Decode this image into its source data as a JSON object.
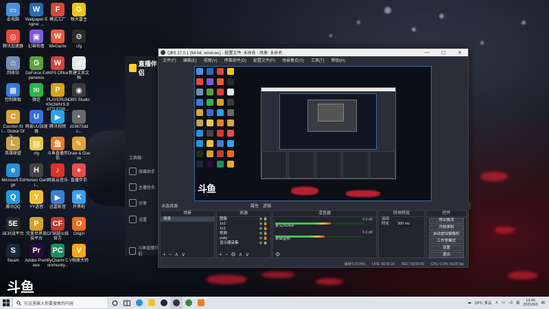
{
  "desktop": {
    "icons": [
      {
        "label": "此电脑",
        "color": "#4a90d9",
        "glyph": "▭"
      },
      {
        "label": "Wallpaper Engine: ...",
        "color": "#2a6db0",
        "glyph": "W"
      },
      {
        "label": "模式工厂",
        "color": "#d44a3a",
        "glyph": "F"
      },
      {
        "label": "帐大富主",
        "color": "#f0c419",
        "glyph": "G"
      },
      {
        "label": "腾讯加速器",
        "color": "#e64a3b",
        "glyph": "◎"
      },
      {
        "label": "幻兽帕鲁",
        "color": "#7c5cd6",
        "glyph": "▣"
      },
      {
        "label": "WeGame",
        "color": "#e85d3d",
        "glyph": "W"
      },
      {
        "label": "cfg",
        "color": "#2b2b2b",
        "glyph": "⚙"
      },
      {
        "label": "回收站",
        "color": "#6f8fb3",
        "glyph": "♲"
      },
      {
        "label": "GeForce Experience",
        "color": "#5aa13a",
        "glyph": "G"
      },
      {
        "label": "WPS Office",
        "color": "#d6423a",
        "glyph": "W"
      },
      {
        "label": "新建文本文档",
        "color": "#e8e8e8",
        "glyph": "≡"
      },
      {
        "label": "控制面板",
        "color": "#3a7bd5",
        "glyph": "▦"
      },
      {
        "label": "微信",
        "color": "#2fb34a",
        "glyph": "✉"
      },
      {
        "label": "PLAYERUNKNOWN'S BATTLEGR...",
        "color": "#d9a21b",
        "glyph": "P"
      },
      {
        "label": "OBS Studio",
        "color": "#3b3b3b",
        "glyph": "◉"
      },
      {
        "label": "Counter-Str... Global Offe...",
        "color": "#d8a53a",
        "glyph": "C"
      },
      {
        "label": "网易UU加速器",
        "color": "#3a6fd8",
        "glyph": "U"
      },
      {
        "label": "腾讯视频",
        "color": "#2aa3e8",
        "glyph": "▶"
      },
      {
        "label": "d19875ddc...",
        "color": "#6a6a6a",
        "glyph": "▪"
      },
      {
        "label": "英雄联盟",
        "color": "#c7a64a",
        "glyph": "L"
      },
      {
        "label": "cfg",
        "color": "#e8c84a",
        "glyph": "▤"
      },
      {
        "label": "斗鱼直播伴侣",
        "color": "#f07c1e",
        "glyph": "鱼"
      },
      {
        "label": "Draw & Guess",
        "color": "#e3a23b",
        "glyph": "✎"
      },
      {
        "label": "Microsoft Edge",
        "color": "#2b8fd6",
        "glyph": "e"
      },
      {
        "label": "Heroes Gami...",
        "color": "#444444",
        "glyph": "H"
      },
      {
        "label": "网易云音乐",
        "color": "#d9342b",
        "glyph": "♪"
      },
      {
        "label": "直播伴侣",
        "color": "#e84b4b",
        "glyph": "●"
      },
      {
        "label": "腾讯QQ",
        "color": "#1f9be0",
        "glyph": "Q"
      },
      {
        "label": "YY语音",
        "color": "#f2c230",
        "glyph": "Y"
      },
      {
        "label": "迅雷影音",
        "color": "#3a7fd6",
        "glyph": "▶"
      },
      {
        "label": "开黑啦",
        "color": "#3aa0f2",
        "glyph": "K"
      },
      {
        "label": "5E对战平台",
        "color": "#2a2a2a",
        "glyph": "5E"
      },
      {
        "label": "完美世界竞技平台",
        "color": "#d6a12a",
        "glyph": "P"
      },
      {
        "label": "CF穿越火线官方",
        "color": "#c23b2b",
        "glyph": "CF"
      },
      {
        "label": "Origin",
        "color": "#f26a1b",
        "glyph": "O"
      },
      {
        "label": "Steam",
        "color": "#1b2838",
        "glyph": "S"
      },
      {
        "label": "Adobe Premiere",
        "color": "#2a0b3d",
        "glyph": "Pr"
      },
      {
        "label": "PyCharm Community...",
        "color": "#1d8f5e",
        "glyph": "PC"
      },
      {
        "label": "V相册大师",
        "color": "#f2a81e",
        "glyph": "V"
      }
    ]
  },
  "companion_app": {
    "title": "直播伴侣",
    "section": "工具箱",
    "items": [
      "弹幕助手",
      "主播任务",
      "分享",
      "设置",
      "斗鱼直播伴侣"
    ]
  },
  "obs": {
    "window_title": "OBS 27.0.1 (64-bit, windows) - 配置文件: 未命名 - 场景: 未命名",
    "window_buttons": [
      "—",
      "☐",
      "✕"
    ],
    "menu": [
      "文件(F)",
      "编辑(E)",
      "视图(V)",
      "停靠部件(D)",
      "配置文件(P)",
      "场景集合(S)",
      "工具(T)",
      "帮助(H)"
    ],
    "scene_bar": {
      "label": "未选择源",
      "properties": "属性",
      "filters": "滤镜"
    },
    "docks": {
      "scenes": {
        "title": "场景",
        "items": [
          "场景"
        ]
      },
      "sources": {
        "title": "来源",
        "items": [
          "图像",
          "1x1",
          "1x1",
          "视频",
          "yuky",
          "显示器采集"
        ]
      },
      "mixer": {
        "title": "混音器",
        "channels": [
          {
            "name": "麦克风/Aux",
            "db": "0.0 dB",
            "level": 0.62
          },
          {
            "name": "桌面音频",
            "db": "0.0 dB",
            "level": 0.55
          }
        ]
      },
      "transitions": {
        "title": "转场特效",
        "type": "淡出",
        "duration_label": "时长",
        "duration": "300 ms"
      },
      "controls": {
        "title": "控件",
        "buttons": [
          "停止推流",
          "开始录制",
          "启动虚拟摄像机",
          "工作室模式",
          "设置",
          "退出"
        ]
      }
    },
    "status": {
      "dropped": "丢帧 0 (0.0%)",
      "live": "LIVE: 00:00:10",
      "rec": "REC: 00:00:00",
      "cpu": "CPU: 0.3%, 60.00 fps"
    }
  },
  "watermark": "斗鱼",
  "taskbar": {
    "search_placeholder": "在这里输入你要搜索的内容",
    "weather": "29°C 多云",
    "time": "13:45",
    "date": "2021/9/2"
  },
  "colors": {
    "accent": "#3a6ea5",
    "obs_bg": "#2b2e38",
    "taskbar": "#dfe3ea",
    "meter_green": "#44c158"
  }
}
